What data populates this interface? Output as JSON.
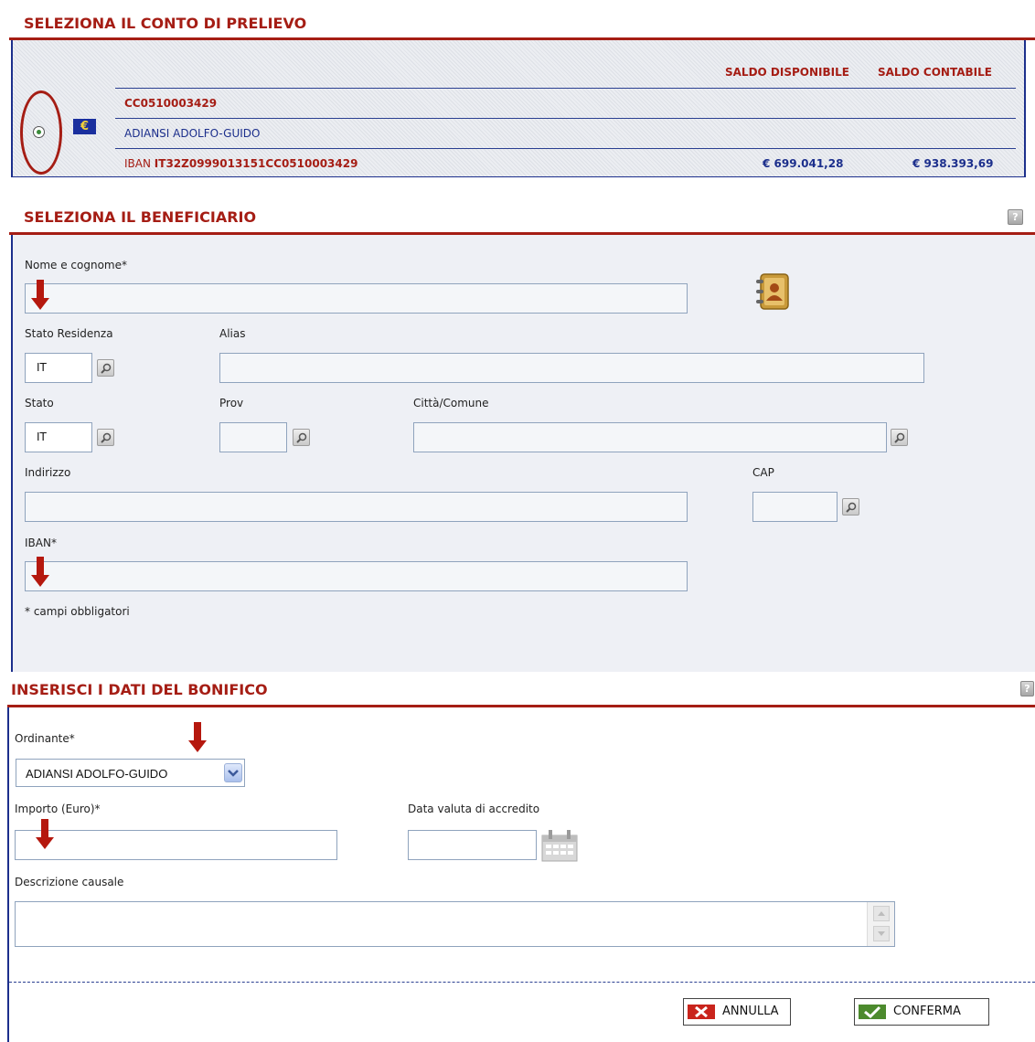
{
  "account_section": {
    "title": "SELEZIONA IL CONTO DI PRELIEVO",
    "col_saldo_disponibile": "SALDO DISPONIBILE",
    "col_saldo_contabile": "SALDO CONTABILE",
    "account_number": "CC0510003429",
    "holder": "ADIANSI ADOLFO-GUIDO",
    "iban_prefix": "IBAN",
    "iban": "IT32Z0999013151CC0510003429",
    "saldo_disponibile": "€ 699.041,28",
    "saldo_contabile": "€ 938.393,69",
    "currency_symbol": "€"
  },
  "beneficiary_section": {
    "title": "SELEZIONA IL BENEFICIARIO",
    "help": "?",
    "nome_label": "Nome e cognome*",
    "stato_residenza_label": "Stato Residenza",
    "stato_residenza_value": "IT",
    "alias_label": "Alias",
    "stato_label": "Stato",
    "stato_value": "IT",
    "prov_label": "Prov",
    "citta_label": "Città/Comune",
    "indirizzo_label": "Indirizzo",
    "cap_label": "CAP",
    "iban_label": "IBAN*",
    "required_note": "* campi obbligatori"
  },
  "transfer_section": {
    "title": "INSERISCI I DATI DEL BONIFICO",
    "help": "?",
    "ordinante_label": "Ordinante*",
    "ordinante_value": "ADIANSI ADOLFO-GUIDO",
    "importo_label": "Importo (Euro)*",
    "data_valuta_label": "Data valuta di accredito",
    "descrizione_label": "Descrizione causale"
  },
  "actions": {
    "annulla": "ANNULLA",
    "conferma": "CONFERMA"
  },
  "colors": {
    "brand_red": "#a51d14",
    "navy": "#1c2f8c",
    "field_border": "#8fa3bd"
  }
}
